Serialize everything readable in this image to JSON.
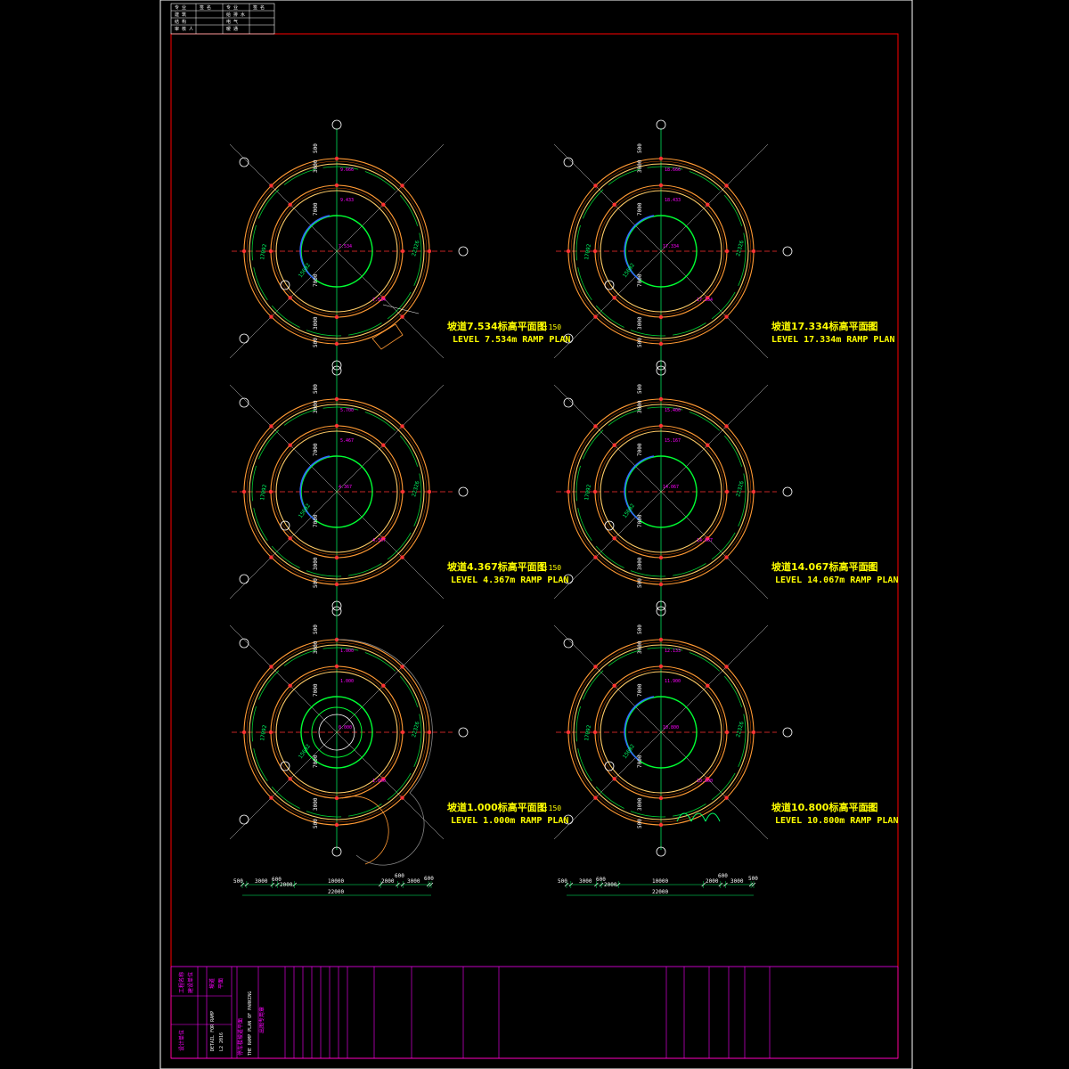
{
  "sheet": {
    "border_color": "#ff0000",
    "outer_frame_color": "#ffffff",
    "title_block_color": "#ff00ff"
  },
  "plans": [
    {
      "id": "p7534",
      "caption_cn": "坡道7.534标高平面图",
      "caption_en": "LEVEL 7.534m RAMP PLAN",
      "scale": "1:150",
      "elev_a": "9.666",
      "elev_b": "9.433",
      "elev_c": "7.534",
      "elev_d": "7.534",
      "elev_e": "0.000"
    },
    {
      "id": "p17334",
      "caption_cn": "坡道17.334标高平面图",
      "caption_en": "LEVEL 17.334m RAMP PLAN",
      "scale": "1:150",
      "elev_a": "18.666",
      "elev_b": "18.433",
      "elev_c": "17.334",
      "elev_d": "17.334"
    },
    {
      "id": "p4367",
      "caption_cn": "坡道4.367标高平面图",
      "caption_en": "LEVEL 4.367m RAMP PLAN",
      "scale": "1:150",
      "elev_a": "5.700",
      "elev_b": "5.467",
      "elev_c": "4.367",
      "elev_d": "4.367"
    },
    {
      "id": "p14067",
      "caption_cn": "坡道14.067标高平面图",
      "caption_en": "LEVEL 14.067m RAMP PLAN",
      "scale": "1:150",
      "elev_a": "15.400",
      "elev_b": "15.167",
      "elev_c": "14.067",
      "elev_d": "14.067"
    },
    {
      "id": "p1000",
      "caption_cn": "坡道1.000标高平面图",
      "caption_en": "LEVEL 1.000m RAMP PLAN",
      "scale": "1:150",
      "elev_a": "1.000",
      "elev_b": "1.000",
      "elev_c": "0.000",
      "elev_d": "1.000"
    },
    {
      "id": "p10800",
      "caption_cn": "坡道10.800标高平面图",
      "caption_en": "LEVEL 10.800m RAMP PLAN",
      "scale": "1:150",
      "elev_a": "12.133",
      "elev_b": "11.900",
      "elev_c": "10.800",
      "elev_d": "10.800"
    }
  ],
  "dims": {
    "left": {
      "segments": [
        "500",
        "3000",
        "600",
        "2000",
        "10000",
        "2000",
        "600",
        "3000",
        "600"
      ],
      "total": "22000"
    },
    "right": {
      "segments": [
        "500",
        "3000",
        "600",
        "2000",
        "10000",
        "2000",
        "600",
        "3000",
        "500"
      ],
      "total": "22000"
    },
    "radial": [
      "500",
      "3000",
      "7000",
      "7000",
      "3000",
      "500"
    ],
    "arc_len": [
      "22326",
      "17092",
      "15692"
    ]
  },
  "title_block": {
    "col1": [
      "工程名称",
      "建设单位",
      "设计单位"
    ],
    "col2": [
      "坡道",
      "平面"
    ],
    "col3": [
      "DETAIL FOR RAMP",
      "L2 2016"
    ],
    "col4": [
      "停车楼坡道平面",
      "THE RAMP PLAN OF PARKING"
    ],
    "stamp": "出图专用章"
  },
  "top_table": {
    "rows": [
      [
        "专 业",
        "签 名",
        "专 业",
        "签 名"
      ],
      [
        "建 筑",
        "",
        "给 排 水",
        ""
      ],
      [
        "结 构",
        "",
        "电 气",
        ""
      ],
      [
        "审 核 人",
        "",
        "暖 通",
        ""
      ]
    ]
  }
}
